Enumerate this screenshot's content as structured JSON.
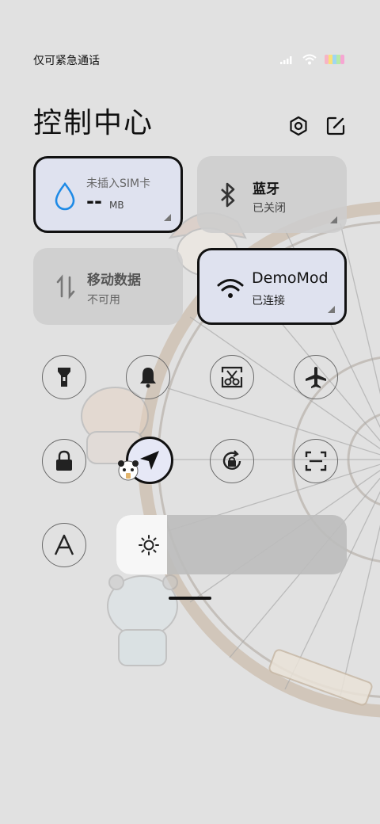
{
  "status_bar": {
    "carrier_text": "仅可紧急通话",
    "icons": [
      "signal-icon",
      "wifi-icon",
      "battery-icon"
    ]
  },
  "header": {
    "title": "控制中心",
    "icons": [
      "settings-icon",
      "edit-icon"
    ]
  },
  "tiles": {
    "data_usage": {
      "label": "未插入SIM卡",
      "value": "--",
      "unit": "MB",
      "active": true
    },
    "bluetooth": {
      "label": "蓝牙",
      "status": "已关闭",
      "active": false
    },
    "mobile_data": {
      "label": "移动数据",
      "status": "不可用",
      "active": false
    },
    "wifi": {
      "label": "DemoMod",
      "status": "已连接",
      "active": true
    }
  },
  "toggles": [
    {
      "name": "flashlight",
      "icon": "flashlight-icon",
      "active": false
    },
    {
      "name": "silent",
      "icon": "bell-icon",
      "active": false
    },
    {
      "name": "screenshot",
      "icon": "scissors-icon",
      "active": false
    },
    {
      "name": "airplane",
      "icon": "airplane-icon",
      "active": false
    },
    {
      "name": "lock-screen",
      "icon": "lock-icon",
      "active": false
    },
    {
      "name": "location",
      "icon": "location-arrow-icon",
      "active": true
    },
    {
      "name": "auto-rotate",
      "icon": "rotation-lock-icon",
      "active": false
    },
    {
      "name": "scanner",
      "icon": "scan-icon",
      "active": false
    },
    {
      "name": "font",
      "icon": "font-a-icon",
      "active": false
    }
  ],
  "brightness": {
    "level": 0.22,
    "icon": "sun-icon"
  },
  "colors": {
    "background": "#e1e1e1",
    "active_tile": "#dfe2ef",
    "inactive_tile": "#cdcdcd",
    "accent_blue": "#1e8ae6",
    "text_primary": "#111111"
  }
}
